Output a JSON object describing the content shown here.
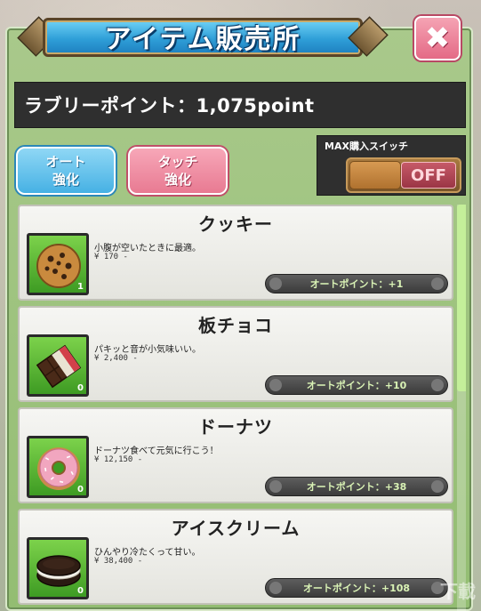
{
  "window": {
    "title": "アイテム販売所",
    "close_label": "✖"
  },
  "points": {
    "text": "ラブリーポイント：1,075point"
  },
  "tabs": [
    {
      "label_line1": "オート",
      "label_line2": "強化"
    },
    {
      "label_line1": "タッチ",
      "label_line2": "強化"
    }
  ],
  "max_switch": {
    "label": "MAX購入スイッチ",
    "state": "OFF"
  },
  "items": [
    {
      "name": "クッキー",
      "desc": "小腹が空いたときに最適。",
      "price": "¥ 170 -",
      "count": "1",
      "auto_point": "オートポイント：+1",
      "icon": "cookie-icon"
    },
    {
      "name": "板チョコ",
      "desc": "パキッと音が小気味いい。",
      "price": "¥ 2,400 -",
      "count": "0",
      "auto_point": "オートポイント：+10",
      "icon": "chocolate-bar-icon"
    },
    {
      "name": "ドーナツ",
      "desc": "ドーナツ食べて元気に行こう！",
      "price": "¥ 12,150 -",
      "count": "0",
      "auto_point": "オートポイント：+38",
      "icon": "donut-icon"
    },
    {
      "name": "アイスクリーム",
      "desc": "ひんやり冷たくって甘い。",
      "price": "¥ 38,400 -",
      "count": "0",
      "auto_point": "オートポイント：+108",
      "icon": "ice-cream-sandwich-icon"
    }
  ],
  "scroll": {
    "position": 0
  },
  "watermark": {
    "text": "下載"
  }
}
